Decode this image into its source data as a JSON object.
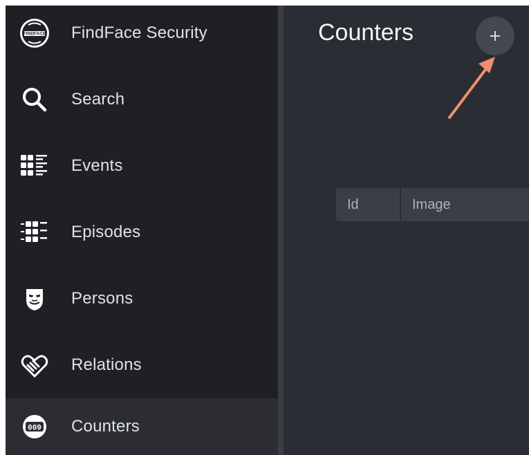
{
  "sidebar": {
    "brand": {
      "label": "FindFace Security",
      "logo_text": "FINDFACE",
      "icon": "findface-logo-icon"
    },
    "items": [
      {
        "label": "Search",
        "icon": "search-icon"
      },
      {
        "label": "Events",
        "icon": "events-grid-icon"
      },
      {
        "label": "Episodes",
        "icon": "episodes-grid-icon"
      },
      {
        "label": "Persons",
        "icon": "mask-icon"
      },
      {
        "label": "Relations",
        "icon": "handshake-icon"
      },
      {
        "label": "Counters",
        "icon": "counter-icon",
        "active": true,
        "icon_text": "009"
      }
    ]
  },
  "main": {
    "title": "Counters",
    "add_button": {
      "label": "+",
      "icon": "plus-icon"
    },
    "table": {
      "columns": [
        "Id",
        "Image"
      ]
    }
  },
  "colors": {
    "sidebar_bg": "#1f2024",
    "main_bg": "#2a2d33",
    "active_item_bg": "#2b2d33",
    "arrow": "#f0906a",
    "text": "#dfe2e6"
  }
}
